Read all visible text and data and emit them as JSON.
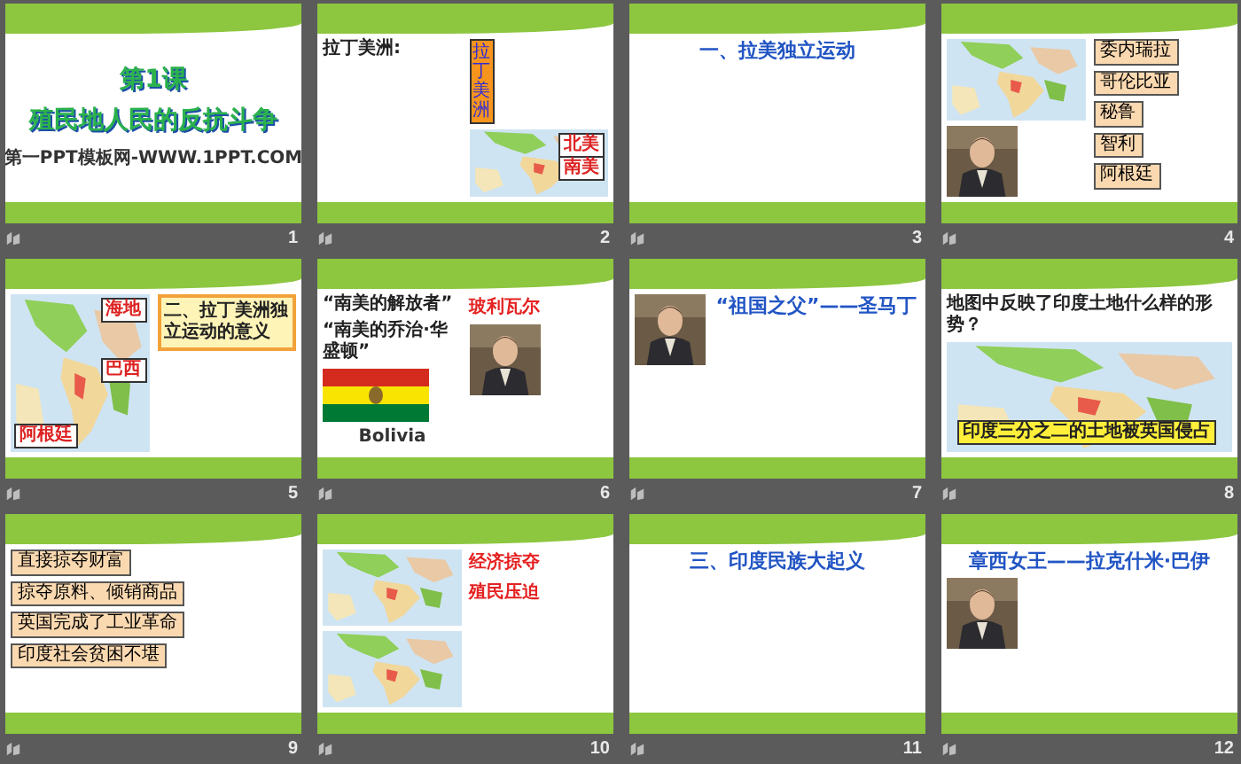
{
  "slides": [
    {
      "number": "1",
      "kind": "cover",
      "main": [
        {
          "kind": "title",
          "text": "第1课"
        },
        {
          "kind": "title",
          "text": "殖民地人民的反抗斗争"
        },
        {
          "kind": "note",
          "text": "第一PPT模板网-WWW.1PPT.COM"
        }
      ]
    },
    {
      "number": "2",
      "kind": "split",
      "main": [
        {
          "kind": "heading",
          "text": "拉丁美洲:"
        }
      ],
      "side": [
        {
          "kind": "vlabel",
          "text": "拉丁美洲"
        },
        {
          "kind": "picture",
          "labels": [
            "北美",
            "南美"
          ]
        }
      ]
    },
    {
      "number": "3",
      "kind": "top",
      "main": [
        {
          "kind": "title",
          "text": "一、拉美独立运动"
        }
      ]
    },
    {
      "number": "4",
      "kind": "split",
      "main": [
        {
          "kind": "picture"
        },
        {
          "kind": "portrait"
        }
      ],
      "side": [
        {
          "kind": "label",
          "text": "委内瑞拉"
        },
        {
          "kind": "label",
          "text": "哥伦比亚"
        },
        {
          "kind": "label",
          "text": "秘鲁"
        },
        {
          "kind": "label",
          "text": "智利"
        },
        {
          "kind": "label",
          "text": "阿根廷"
        }
      ]
    },
    {
      "number": "5",
      "kind": "split",
      "main": [
        {
          "kind": "picture",
          "labels": [
            "海地",
            "巴西",
            "阿根廷"
          ]
        }
      ],
      "side": [
        {
          "kind": "banner",
          "text": "二、拉丁美洲独立运动的意义"
        }
      ]
    },
    {
      "number": "6",
      "kind": "split",
      "main": [
        {
          "kind": "heading",
          "text": "“南美的解放者”"
        },
        {
          "kind": "heading",
          "text": "“南美的乔治·华盛顿”"
        },
        {
          "kind": "flag"
        },
        {
          "kind": "note",
          "text": "Bolivia"
        }
      ],
      "side": [
        {
          "kind": "emph",
          "text": "玻利瓦尔"
        },
        {
          "kind": "portrait"
        }
      ]
    },
    {
      "number": "7",
      "kind": "split",
      "main": [
        {
          "kind": "portrait"
        }
      ],
      "side": [
        {
          "kind": "title",
          "text": "“祖国之父”——圣马丁"
        }
      ]
    },
    {
      "number": "8",
      "kind": "top",
      "main": [
        {
          "kind": "heading",
          "text": "地图中反映了印度土地什么样的形势？"
        },
        {
          "kind": "picture",
          "labels": [
            "印度三分之二的土地被英国侵占"
          ]
        }
      ]
    },
    {
      "number": "9",
      "kind": "top",
      "main": [
        {
          "kind": "label",
          "text": "直接掠夺财富"
        },
        {
          "kind": "label",
          "text": "掠夺原料、倾销商品"
        },
        {
          "kind": "label",
          "text": "英国完成了工业革命"
        },
        {
          "kind": "label",
          "text": "印度社会贫困不堪"
        }
      ]
    },
    {
      "number": "10",
      "kind": "split",
      "main": [
        {
          "kind": "picture"
        },
        {
          "kind": "picture"
        }
      ],
      "side": [
        {
          "kind": "emph",
          "text": "经济掠夺"
        },
        {
          "kind": "emph",
          "text": "殖民压迫"
        }
      ]
    },
    {
      "number": "11",
      "kind": "top",
      "main": [
        {
          "kind": "title",
          "text": "三、印度民族大起义"
        }
      ]
    },
    {
      "number": "12",
      "kind": "top",
      "main": [
        {
          "kind": "title",
          "text": "章西女王——拉克什米·巴伊"
        },
        {
          "kind": "portrait"
        }
      ]
    }
  ]
}
